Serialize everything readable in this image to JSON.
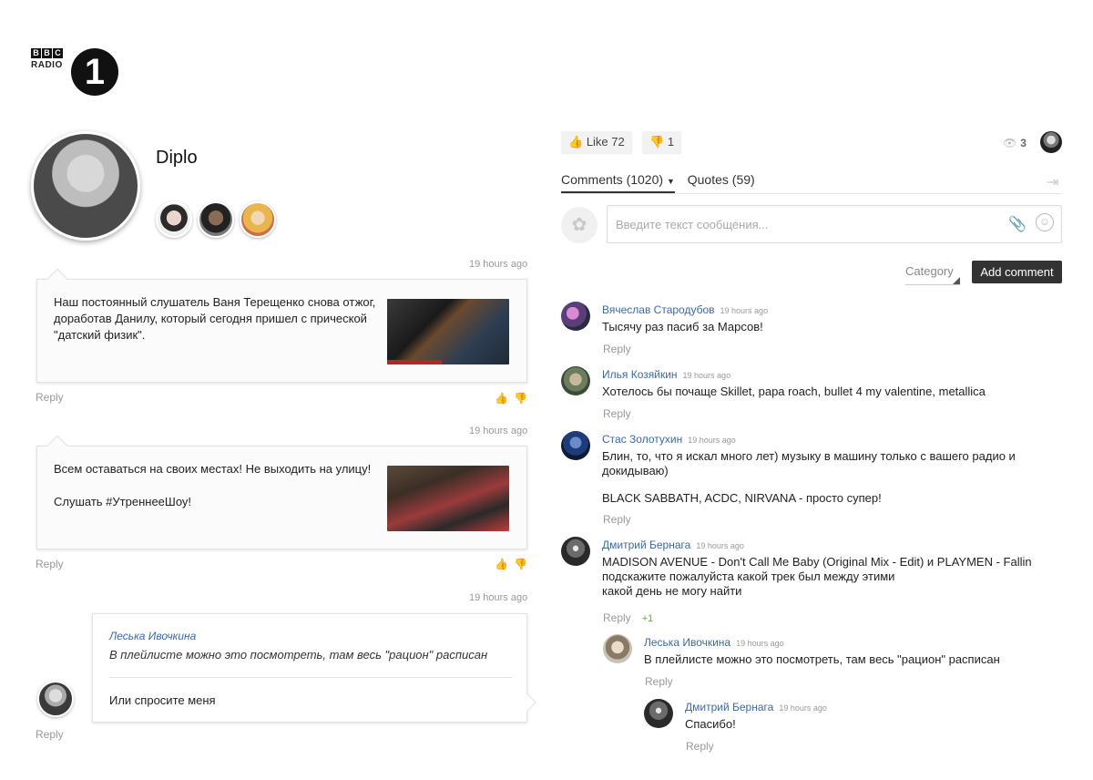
{
  "brand": {
    "bbc": [
      "B",
      "B",
      "C"
    ],
    "radio": "RADIO",
    "number": "1"
  },
  "profile": {
    "name": "Diplo"
  },
  "left_posts": [
    {
      "time": "19 hours ago",
      "text_lines": [
        "Наш постоянный слушатель Ваня Терещенко снова отжог,",
        "доработав Данилу, который сегодня пришел с прической",
        "\"датский физик\"."
      ],
      "reply": "Reply"
    },
    {
      "time": "19 hours ago",
      "text_lines": [
        "Всем оставаться на своих местах! Не выходить на улицу!",
        "",
        "Слушать #УтреннееШоу!"
      ],
      "reply": "Reply"
    },
    {
      "time": "19 hours ago",
      "quote_author": "Леська Ивочкина",
      "quote_text": "В плейлисте можно это посмотреть, там весь \"рацион\" расписан",
      "text": "Или спросите меня",
      "reply": "Reply"
    }
  ],
  "toolbar": {
    "like_label": "Like",
    "like_count": "72",
    "dislike_count": "1",
    "views": "3"
  },
  "tabs": {
    "comments": "Comments (1020)",
    "quotes": "Quotes (59)"
  },
  "composer": {
    "placeholder": "Введите текст сообщения..."
  },
  "category_label": "Category",
  "add_comment_label": "Add comment",
  "comments": [
    {
      "name": "Вячеслав Стародубов",
      "time": "19 hours ago",
      "lines": [
        "Тысячу раз пасиб за Марсов!"
      ],
      "reply": "Reply"
    },
    {
      "name": "Илья Козяйкин",
      "time": "19 hours ago",
      "lines": [
        "Хотелось бы почаще Skillet, papa roach, bullet 4 my valentine, metallica"
      ],
      "reply": "Reply"
    },
    {
      "name": "Стас Золотухин",
      "time": "19 hours ago",
      "lines": [
        "Блин, то, что я искал много лет) музыку в машину только с вашего радио и",
        "докидываю)",
        "",
        "BLACK SABBATH, ACDC, NIRVANA - просто супер!"
      ],
      "reply": "Reply"
    },
    {
      "name": "Дмитрий Бернага",
      "time": "19 hours ago",
      "lines": [
        "MADISON AVENUE - Don't Call Me Baby (Original Mix - Edit) и PLAYMEN - Fallin",
        "подскажите пожалуйста какой трек был между этими",
        "какой день не могу найти"
      ],
      "reply": "Reply",
      "plus": "+1"
    },
    {
      "name": "Леська Ивочкина",
      "time": "19 hours ago",
      "lines": [
        "В плейлисте можно это посмотреть, там весь \"рацион\" расписан"
      ],
      "reply": "Reply"
    },
    {
      "name": "Дмитрий Бернага",
      "time": "19 hours ago",
      "lines": [
        "Спасибо!"
      ],
      "reply": "Reply"
    }
  ],
  "icons": [
    "bbc-radio-1-logo",
    "thumb-up-icon",
    "thumb-down-icon",
    "eye-icon",
    "sign-in-icon",
    "paperclip-icon",
    "smile-icon"
  ]
}
